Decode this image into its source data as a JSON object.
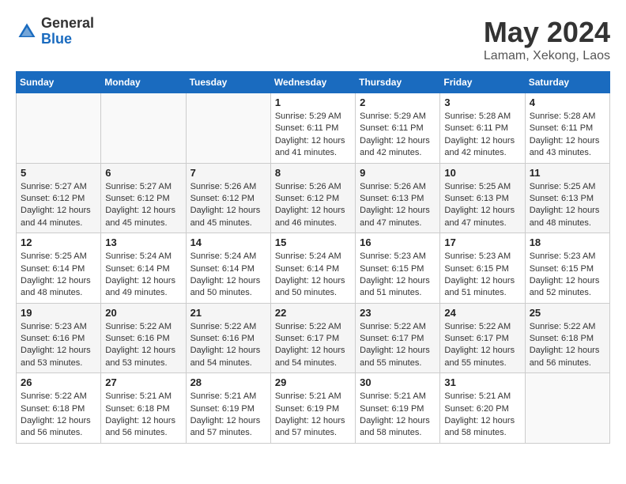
{
  "header": {
    "logo": {
      "general": "General",
      "blue": "Blue"
    },
    "title": "May 2024",
    "location": "Lamam, Xekong, Laos"
  },
  "weekdays": [
    "Sunday",
    "Monday",
    "Tuesday",
    "Wednesday",
    "Thursday",
    "Friday",
    "Saturday"
  ],
  "weeks": [
    [
      {
        "day": "",
        "info": ""
      },
      {
        "day": "",
        "info": ""
      },
      {
        "day": "",
        "info": ""
      },
      {
        "day": "1",
        "info": "Sunrise: 5:29 AM\nSunset: 6:11 PM\nDaylight: 12 hours\nand 41 minutes."
      },
      {
        "day": "2",
        "info": "Sunrise: 5:29 AM\nSunset: 6:11 PM\nDaylight: 12 hours\nand 42 minutes."
      },
      {
        "day": "3",
        "info": "Sunrise: 5:28 AM\nSunset: 6:11 PM\nDaylight: 12 hours\nand 42 minutes."
      },
      {
        "day": "4",
        "info": "Sunrise: 5:28 AM\nSunset: 6:11 PM\nDaylight: 12 hours\nand 43 minutes."
      }
    ],
    [
      {
        "day": "5",
        "info": "Sunrise: 5:27 AM\nSunset: 6:12 PM\nDaylight: 12 hours\nand 44 minutes."
      },
      {
        "day": "6",
        "info": "Sunrise: 5:27 AM\nSunset: 6:12 PM\nDaylight: 12 hours\nand 45 minutes."
      },
      {
        "day": "7",
        "info": "Sunrise: 5:26 AM\nSunset: 6:12 PM\nDaylight: 12 hours\nand 45 minutes."
      },
      {
        "day": "8",
        "info": "Sunrise: 5:26 AM\nSunset: 6:12 PM\nDaylight: 12 hours\nand 46 minutes."
      },
      {
        "day": "9",
        "info": "Sunrise: 5:26 AM\nSunset: 6:13 PM\nDaylight: 12 hours\nand 47 minutes."
      },
      {
        "day": "10",
        "info": "Sunrise: 5:25 AM\nSunset: 6:13 PM\nDaylight: 12 hours\nand 47 minutes."
      },
      {
        "day": "11",
        "info": "Sunrise: 5:25 AM\nSunset: 6:13 PM\nDaylight: 12 hours\nand 48 minutes."
      }
    ],
    [
      {
        "day": "12",
        "info": "Sunrise: 5:25 AM\nSunset: 6:14 PM\nDaylight: 12 hours\nand 48 minutes."
      },
      {
        "day": "13",
        "info": "Sunrise: 5:24 AM\nSunset: 6:14 PM\nDaylight: 12 hours\nand 49 minutes."
      },
      {
        "day": "14",
        "info": "Sunrise: 5:24 AM\nSunset: 6:14 PM\nDaylight: 12 hours\nand 50 minutes."
      },
      {
        "day": "15",
        "info": "Sunrise: 5:24 AM\nSunset: 6:14 PM\nDaylight: 12 hours\nand 50 minutes."
      },
      {
        "day": "16",
        "info": "Sunrise: 5:23 AM\nSunset: 6:15 PM\nDaylight: 12 hours\nand 51 minutes."
      },
      {
        "day": "17",
        "info": "Sunrise: 5:23 AM\nSunset: 6:15 PM\nDaylight: 12 hours\nand 51 minutes."
      },
      {
        "day": "18",
        "info": "Sunrise: 5:23 AM\nSunset: 6:15 PM\nDaylight: 12 hours\nand 52 minutes."
      }
    ],
    [
      {
        "day": "19",
        "info": "Sunrise: 5:23 AM\nSunset: 6:16 PM\nDaylight: 12 hours\nand 53 minutes."
      },
      {
        "day": "20",
        "info": "Sunrise: 5:22 AM\nSunset: 6:16 PM\nDaylight: 12 hours\nand 53 minutes."
      },
      {
        "day": "21",
        "info": "Sunrise: 5:22 AM\nSunset: 6:16 PM\nDaylight: 12 hours\nand 54 minutes."
      },
      {
        "day": "22",
        "info": "Sunrise: 5:22 AM\nSunset: 6:17 PM\nDaylight: 12 hours\nand 54 minutes."
      },
      {
        "day": "23",
        "info": "Sunrise: 5:22 AM\nSunset: 6:17 PM\nDaylight: 12 hours\nand 55 minutes."
      },
      {
        "day": "24",
        "info": "Sunrise: 5:22 AM\nSunset: 6:17 PM\nDaylight: 12 hours\nand 55 minutes."
      },
      {
        "day": "25",
        "info": "Sunrise: 5:22 AM\nSunset: 6:18 PM\nDaylight: 12 hours\nand 56 minutes."
      }
    ],
    [
      {
        "day": "26",
        "info": "Sunrise: 5:22 AM\nSunset: 6:18 PM\nDaylight: 12 hours\nand 56 minutes."
      },
      {
        "day": "27",
        "info": "Sunrise: 5:21 AM\nSunset: 6:18 PM\nDaylight: 12 hours\nand 56 minutes."
      },
      {
        "day": "28",
        "info": "Sunrise: 5:21 AM\nSunset: 6:19 PM\nDaylight: 12 hours\nand 57 minutes."
      },
      {
        "day": "29",
        "info": "Sunrise: 5:21 AM\nSunset: 6:19 PM\nDaylight: 12 hours\nand 57 minutes."
      },
      {
        "day": "30",
        "info": "Sunrise: 5:21 AM\nSunset: 6:19 PM\nDaylight: 12 hours\nand 58 minutes."
      },
      {
        "day": "31",
        "info": "Sunrise: 5:21 AM\nSunset: 6:20 PM\nDaylight: 12 hours\nand 58 minutes."
      },
      {
        "day": "",
        "info": ""
      }
    ]
  ]
}
